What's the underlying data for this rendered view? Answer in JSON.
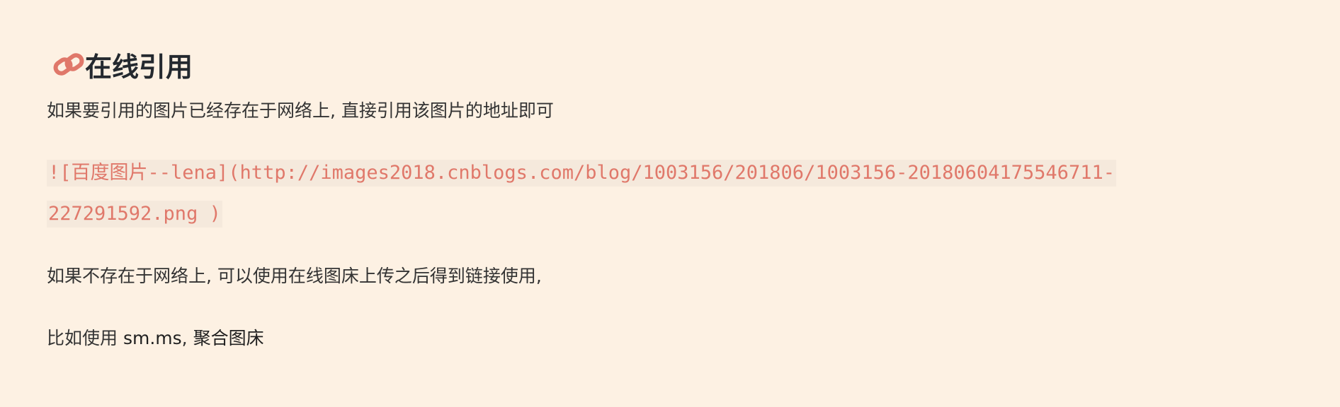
{
  "heading": {
    "title": "在线引用",
    "icon": "link-icon",
    "icon_color": "#e0786a"
  },
  "paragraphs": {
    "intro": "如果要引用的图片已经存在于网络上, 直接引用该图片的地址即可",
    "not_online": "如果不存在于网络上, 可以使用在线图床上传之后得到链接使用,",
    "example_prefix": "比如使用 ",
    "example_sep": ", ",
    "links": [
      "sm.ms",
      "聚合图床"
    ]
  },
  "code": {
    "line1": "![百度图片--lena](http://images2018.cnblogs.com/blog/1003156/201806/1003156-20180604175546711-",
    "line2": "227291592.png )",
    "color": "#e0786a"
  }
}
